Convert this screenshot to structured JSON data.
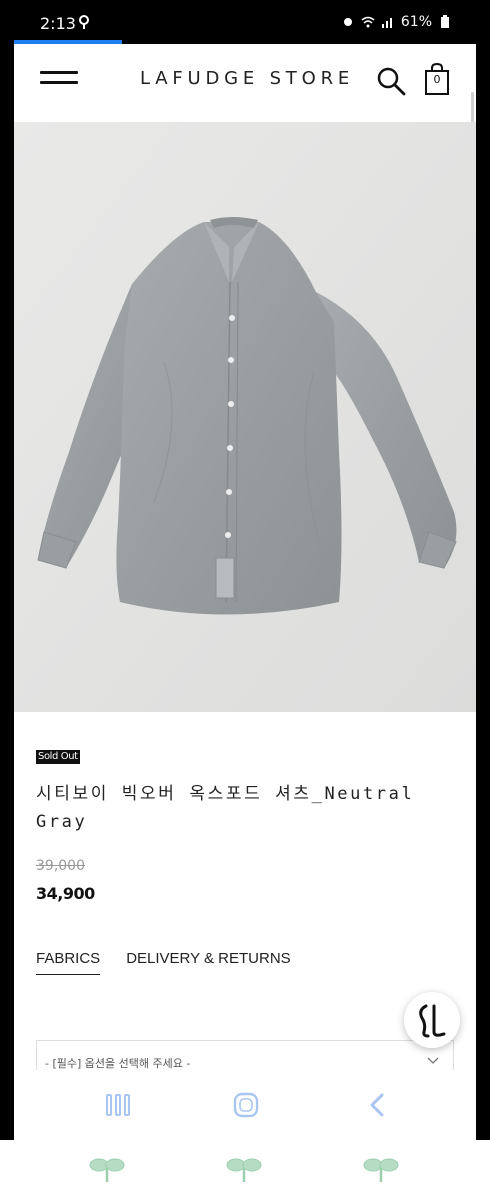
{
  "status_bar": {
    "time": "2:13",
    "battery": "61%"
  },
  "header": {
    "store_name": "LAFUDGE STORE",
    "cart_count": "0",
    "menu_icon": "hamburger-icon",
    "search_icon": "search-icon",
    "cart_icon": "shopping-bag-icon"
  },
  "product": {
    "image_subject": "gray oversized button-up shirt",
    "badge": "Sold Out",
    "name_line1": "시티보이 빅오버 옥스포드 셔츠_Neutral",
    "name_line2": "Gray",
    "original_price": "39,000",
    "sale_price": "34,900"
  },
  "tabs": [
    {
      "label": "FABRICS",
      "active": true
    },
    {
      "label": "DELIVERY & RETURNS",
      "active": false
    }
  ],
  "option_select": {
    "placeholder": "- [필수] 옵션을 선택해 주세요 -"
  },
  "nav": {
    "recents_icon": "recent-apps-icon",
    "home_icon": "home-icon",
    "back_icon": "back-icon"
  },
  "colors": {
    "accent_blue": "#1e7ef2",
    "nav_icon": "#a9c6f2",
    "sprout": "#9ccfb0"
  }
}
